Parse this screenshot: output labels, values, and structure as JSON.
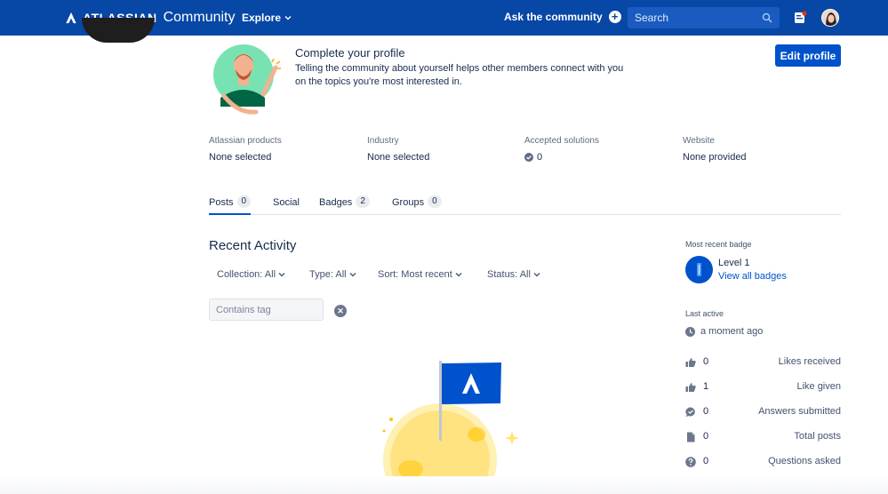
{
  "nav": {
    "logo_word": "ATLASSIAN",
    "logo_community": "Community",
    "explore": "Explore",
    "ask": "Ask the community",
    "search_placeholder": "Search"
  },
  "profile_prompt": {
    "title": "Complete your profile",
    "text": "Telling the community about yourself helps other members connect with you on the topics you're most interested in.",
    "edit_button": "Edit profile"
  },
  "info": [
    {
      "label": "Atlassian products",
      "value": "None selected"
    },
    {
      "label": "Industry",
      "value": "None selected"
    },
    {
      "label": "Accepted solutions",
      "value": "0"
    },
    {
      "label": "Website",
      "value": "None provided"
    }
  ],
  "tabs": [
    {
      "label": "Posts",
      "count": "0",
      "active": true
    },
    {
      "label": "Social",
      "count": "",
      "active": false
    },
    {
      "label": "Badges",
      "count": "2",
      "active": false
    },
    {
      "label": "Groups",
      "count": "0",
      "active": false
    }
  ],
  "activity": {
    "title": "Recent Activity",
    "filters": [
      "Collection: All",
      "Type: All",
      "Sort: Most recent",
      "Status: All"
    ],
    "tag_placeholder": "Contains tag"
  },
  "sidebar": {
    "badge_heading": "Most recent badge",
    "badge_level": "Level 1",
    "badge_link": "View all badges",
    "last_active_heading": "Last active",
    "last_active": "a moment ago",
    "stats": [
      {
        "icon": "thumbs-up-icon",
        "value": "0",
        "label": "Likes received"
      },
      {
        "icon": "thumbs-up-icon",
        "value": "1",
        "label": "Like given"
      },
      {
        "icon": "answer-bubble-icon",
        "value": "0",
        "label": "Answers submitted"
      },
      {
        "icon": "document-icon",
        "value": "0",
        "label": "Total posts"
      },
      {
        "icon": "question-icon",
        "value": "0",
        "label": "Questions asked"
      }
    ]
  },
  "colors": {
    "nav_bg": "#0747a6",
    "primary": "#0052cc",
    "text": "#172b4d"
  }
}
